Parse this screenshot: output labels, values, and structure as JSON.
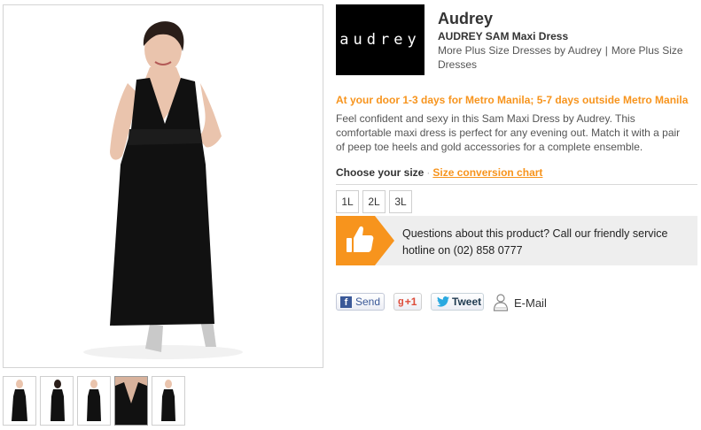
{
  "product": {
    "brand": "Audrey",
    "name": "AUDREY SAM Maxi Dress",
    "logo_text": "audrey",
    "more_link_1": "More Plus Size Dresses by Audrey",
    "separator": "|",
    "more_link_2": "More Plus Size Dresses",
    "delivery": "At your door 1-3 days for Metro Manila; 5-7 days outside Metro Manila",
    "description": "Feel confident and sexy in this Sam Maxi Dress by Audrey. This comfortable maxi dress is perfect for any evening out. Match it with a pair of peep toe heels and gold accessories for a complete ensemble."
  },
  "sizes": {
    "heading": "Choose your size",
    "separator": "·",
    "chart_link": "Size conversion chart",
    "options": [
      "1L",
      "2L",
      "3L"
    ]
  },
  "help": {
    "text": "Questions about this product? Call our friendly service hotline on (02) 858 0777"
  },
  "share": {
    "facebook_label": "Send",
    "facebook_icon_glyph": "f",
    "gplus_glyph": "g",
    "gplus_label": "+1",
    "twitter_label": "Tweet",
    "email_label": "E-Mail"
  },
  "colors": {
    "accent_orange": "#f7941d",
    "dress": "#111111",
    "help_bg": "#eeeeee"
  },
  "icons": [
    "thumbs-up-icon",
    "facebook-icon",
    "google-plus-icon",
    "twitter-bird-icon",
    "email-person-icon"
  ]
}
